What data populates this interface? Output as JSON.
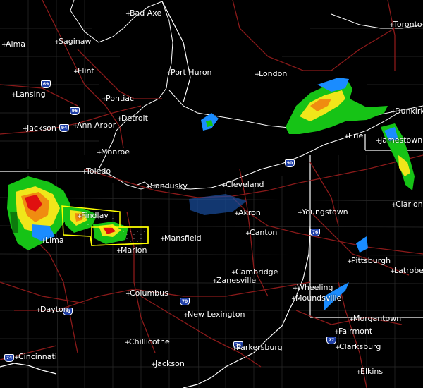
{
  "map": {
    "cities": [
      {
        "name": "Bad Axe",
        "id": "bad-axe"
      },
      {
        "name": "Toronto",
        "id": "toronto"
      },
      {
        "name": "Alma",
        "id": "alma"
      },
      {
        "name": "Saginaw",
        "id": "saginaw"
      },
      {
        "name": "Flint",
        "id": "flint"
      },
      {
        "name": "Port Huron",
        "id": "port-huron"
      },
      {
        "name": "London",
        "id": "london"
      },
      {
        "name": "Lansing",
        "id": "lansing"
      },
      {
        "name": "Pontiac",
        "id": "pontiac"
      },
      {
        "name": "Detroit",
        "id": "detroit"
      },
      {
        "name": "Jackson",
        "id": "jackson-mi"
      },
      {
        "name": "Ann Arbor",
        "id": "ann-arbor"
      },
      {
        "name": "Dunkirk",
        "id": "dunkirk"
      },
      {
        "name": "Monroe",
        "id": "monroe"
      },
      {
        "name": "Erie",
        "id": "erie"
      },
      {
        "name": "Jamestown",
        "id": "jamestown"
      },
      {
        "name": "Toledo",
        "id": "toledo"
      },
      {
        "name": "Sandusky",
        "id": "sandusky"
      },
      {
        "name": "Cleveland",
        "id": "cleveland"
      },
      {
        "name": "Akron",
        "id": "akron"
      },
      {
        "name": "Youngstown",
        "id": "youngstown"
      },
      {
        "name": "Clarion",
        "id": "clarion"
      },
      {
        "name": "Findlay",
        "id": "findlay"
      },
      {
        "name": "Lima",
        "id": "lima"
      },
      {
        "name": "Mansfield",
        "id": "mansfield"
      },
      {
        "name": "Canton",
        "id": "canton"
      },
      {
        "name": "Marion",
        "id": "marion"
      },
      {
        "name": "Pittsburgh",
        "id": "pittsburgh"
      },
      {
        "name": "Latrobe",
        "id": "latrobe"
      },
      {
        "name": "Columbus",
        "id": "columbus"
      },
      {
        "name": "Zanesville",
        "id": "zanesville"
      },
      {
        "name": "Cambridge",
        "id": "cambridge"
      },
      {
        "name": "Wheeling",
        "id": "wheeling"
      },
      {
        "name": "Moundsville",
        "id": "moundsville"
      },
      {
        "name": "Dayton",
        "id": "dayton"
      },
      {
        "name": "New Lexington",
        "id": "new-lexington"
      },
      {
        "name": "Morgantown",
        "id": "morgantown"
      },
      {
        "name": "Fairmont",
        "id": "fairmont"
      },
      {
        "name": "Chillicothe",
        "id": "chillicothe"
      },
      {
        "name": "Parkersburg",
        "id": "parkersburg"
      },
      {
        "name": "Clarksburg",
        "id": "clarksburg"
      },
      {
        "name": "Cincinnati",
        "id": "cincinnati"
      },
      {
        "name": "Jackson",
        "id": "jackson-oh"
      },
      {
        "name": "Elkins",
        "id": "elkins"
      }
    ],
    "shields": [
      "69",
      "96",
      "94",
      "90",
      "76",
      "70",
      "71",
      "79",
      "77",
      "74"
    ],
    "colors": {
      "background": "#000000",
      "roads": "#8b1a1a",
      "state_borders": "#ffffff",
      "warning_polygon": "#ffff00"
    }
  }
}
